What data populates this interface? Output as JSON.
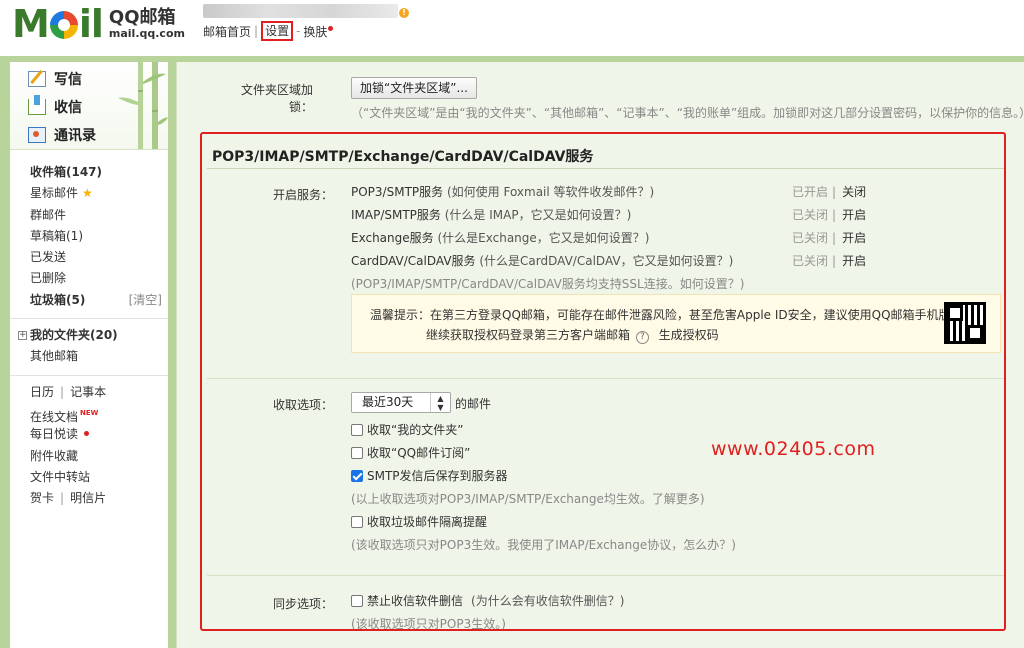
{
  "header": {
    "logo_text": "Mail",
    "product_name": "QQ邮箱",
    "domain": "mail.qq.com",
    "nav": {
      "home": "邮箱首页",
      "settings": "设置",
      "skin": "换肤"
    }
  },
  "sidebar": {
    "compose": {
      "write": "写信",
      "inbox": "收信",
      "contacts": "通讯录"
    },
    "folders": {
      "inbox": "收件箱(147)",
      "starred": "星标邮件",
      "group": "群邮件",
      "drafts": "草稿箱(1)",
      "sent": "已发送",
      "deleted": "已删除",
      "spam": "垃圾箱(5)",
      "spam_clear": "[清空]",
      "my_folders": "我的文件夹(20)",
      "other_mailbox": "其他邮箱"
    },
    "apps": {
      "calendar": "日历",
      "notes": "记事本",
      "online_docs": "在线文档",
      "new_tag": "NEW",
      "daily_reading": "每日悦读",
      "attachments": "附件收藏",
      "file_transfer": "文件中转站",
      "cards": "贺卡",
      "postcards": "明信片"
    }
  },
  "content": {
    "folder_encrypt": {
      "label": "文件夹区域加锁：",
      "button": "加锁“文件夹区域”...",
      "hint": "（“文件夹区域”是由“我的文件夹”、“其他邮箱”、“记事本”、“我的账单”组成。加锁即对这几部分设置密码，以保护你的信息。）"
    },
    "section_title": "POP3/IMAP/SMTP/Exchange/CardDAV/CalDAV服务",
    "services": {
      "label": "开启服务：",
      "items": [
        {
          "name": "POP3/SMTP服务",
          "help": "(如何使用 Foxmail 等软件收发邮件？)",
          "status": "已开启",
          "action": "关闭"
        },
        {
          "name": "IMAP/SMTP服务",
          "help": "(什么是 IMAP，它又是如何设置？)",
          "status": "已关闭",
          "action": "开启"
        },
        {
          "name": "Exchange服务",
          "help": "(什么是Exchange，它又是如何设置？)",
          "status": "已关闭",
          "action": "开启"
        },
        {
          "name": "CardDAV/CalDAV服务",
          "help": "(什么是CardDAV/CalDAV，它又是如何设置？)",
          "status": "已关闭",
          "action": "开启"
        }
      ],
      "ssl_hint": "(POP3/IMAP/SMTP/CardDAV/CalDAV服务均支持SSL连接。如何设置？)"
    },
    "tip": {
      "line1": "温馨提示：在第三方登录QQ邮箱，可能存在邮件泄露风险，甚至危害Apple ID安全，建议使用QQ邮箱手机版登录。",
      "line2": "继续获取授权码登录第三方客户端邮箱",
      "help_glyph": "?",
      "link": "生成授权码"
    },
    "receive": {
      "label": "收取选项：",
      "select_value": "最近30天",
      "select_suffix": "的邮件",
      "options": [
        {
          "text": "收取“我的文件夹”",
          "checked": false
        },
        {
          "text": "收取“QQ邮件订阅”",
          "checked": false
        },
        {
          "text": "SMTP发信后保存到服务器",
          "checked": true
        }
      ],
      "hint1": "(以上收取选项对POP3/IMAP/SMTP/Exchange均生效。了解更多)",
      "spam_option": "收取垃圾邮件隔离提醒",
      "hint2": "(该收取选项只对POP3生效。我使用了IMAP/Exchange协议，怎么办？)"
    },
    "sync": {
      "label": "同步选项：",
      "option": "禁止收信软件删信",
      "option_help": "(为什么会有收信软件删信？)",
      "hint": "(该收取选项只对POP3生效。)"
    },
    "watermark": "www.02405.com"
  },
  "colors": {
    "accent_red": "#e02020",
    "frame_green": "#b8d49a",
    "content_bg": "#eff5e8",
    "checkbox_blue": "#1a73e8"
  }
}
